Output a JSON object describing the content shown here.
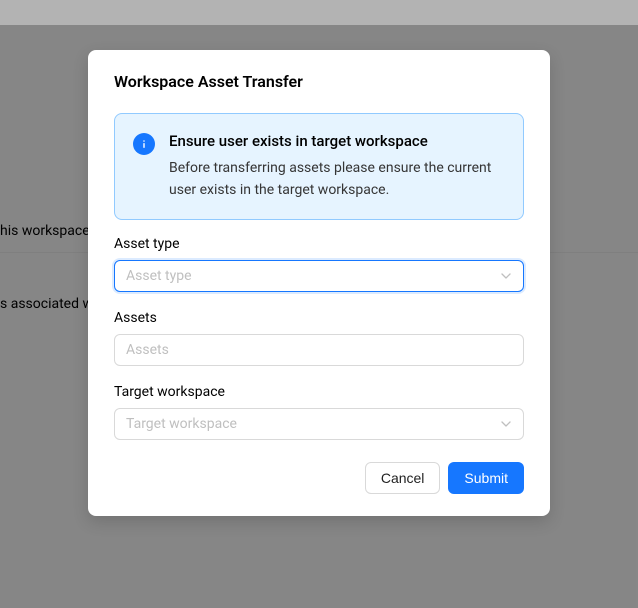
{
  "background": {
    "text1": "his workspace",
    "text2": "s associated w"
  },
  "modal": {
    "title": "Workspace Asset Transfer",
    "alert": {
      "title": "Ensure user exists in target workspace",
      "description": "Before transferring assets please ensure the current user exists in the target workspace."
    },
    "fields": {
      "assetType": {
        "label": "Asset type",
        "placeholder": "Asset type"
      },
      "assets": {
        "label": "Assets",
        "placeholder": "Assets"
      },
      "targetWorkspace": {
        "label": "Target workspace",
        "placeholder": "Target workspace"
      }
    },
    "buttons": {
      "cancel": "Cancel",
      "submit": "Submit"
    }
  }
}
